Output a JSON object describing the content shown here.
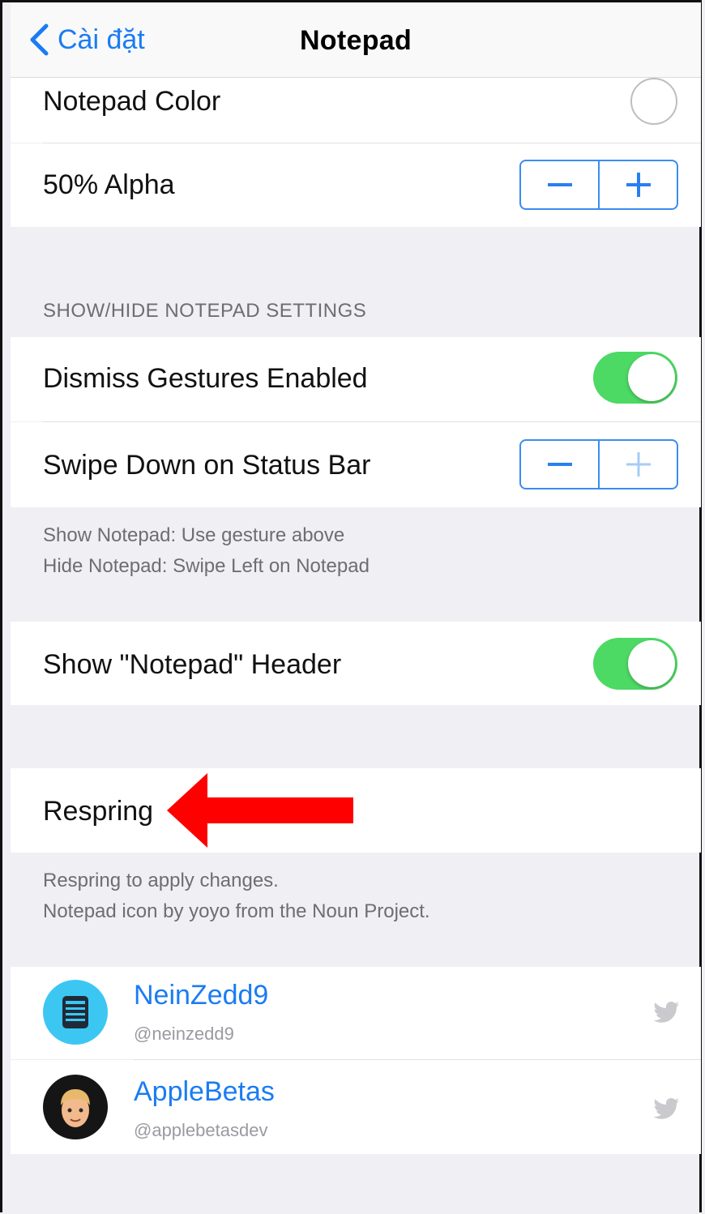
{
  "nav": {
    "back_label": "Cài đặt",
    "title": "Notepad"
  },
  "rows": {
    "notepad_color": "Notepad Color",
    "alpha": "50% Alpha",
    "dismiss_gestures": "Dismiss Gestures Enabled",
    "swipe_down": "Swipe Down on Status Bar",
    "show_header": "Show \"Notepad\" Header"
  },
  "toggles": {
    "dismiss_gestures_on": true,
    "show_header_on": true
  },
  "section_header": "SHOW/HIDE NOTEPAD SETTINGS",
  "gesture_footer": {
    "line1": "Show Notepad: Use gesture above",
    "line2": "Hide Notepad: Swipe Left on Notepad"
  },
  "respring": {
    "label": "Respring",
    "footer_line1": "Respring to apply changes.",
    "footer_line2": "Notepad icon by yoyo from the Noun Project."
  },
  "contacts": [
    {
      "name": "NeinZedd9",
      "handle": "@neinzedd9",
      "icon": "twitter-bird-icon"
    },
    {
      "name": "AppleBetas",
      "handle": "@applebetasdev",
      "icon": "twitter-bird-icon"
    }
  ],
  "colors": {
    "accent": "#1a7cf3",
    "toggle_on": "#4cd964",
    "annotation_arrow": "#ff0000"
  }
}
